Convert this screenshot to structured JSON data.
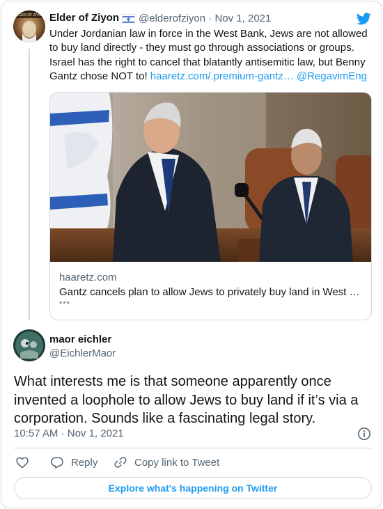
{
  "quoted_tweet": {
    "author_name": "Elder of Ziyon",
    "author_avatar_text": "ELDER OF ZIYON",
    "flag_icon": "israel-flag-icon",
    "handle": "@elderofziyon",
    "separator": "·",
    "date": "Nov 1, 2021",
    "text": "Under Jordanian law in force in the West Bank, Jews are not allowed to buy land directly - they must go through associations or groups. Israel has the right to cancel that blatantly antisemitic law, but Benny Gantz chose NOT to! ",
    "link_text": "haaretz.com/.premium-gantz…",
    "mention": "@RegavimEng",
    "link_card": {
      "domain": "haaretz.com",
      "title": "Gantz cancels plan to allow Jews to privately buy land in West …",
      "description": "***"
    }
  },
  "tweet": {
    "author_name": "maor eichler",
    "handle": "@EichlerMaor",
    "text": "What interests me is that someone apparently once invented a loophole to allow Jews to buy land if it’s via a corporation. Sounds like a fascinating legal story.",
    "time": "10:57 AM",
    "separator": "·",
    "date": "Nov 1, 2021"
  },
  "actions": {
    "like_icon": "heart-icon",
    "reply_label": "Reply",
    "copy_link_label": "Copy link to Tweet"
  },
  "explore_label": "Explore what's happening on Twitter",
  "colors": {
    "accent": "#1d9bf0",
    "text": "#0f1419",
    "muted": "#536471",
    "border": "#cfd9de"
  }
}
